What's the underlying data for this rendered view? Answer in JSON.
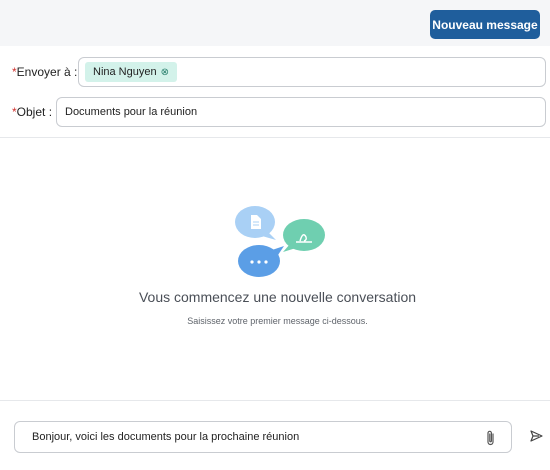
{
  "header": {
    "new_message_label": "Nouveau message"
  },
  "form": {
    "required_mark": "*",
    "to_label": "Envoyer à :",
    "recipients": [
      {
        "name": "Nina Nguyen"
      }
    ],
    "chip_remove_glyph": "⊗",
    "subject_label": "Objet :",
    "subject_value": "Documents pour la réunion"
  },
  "empty_state": {
    "title": "Vous commencez une nouvelle conversation",
    "subtitle": "Saisissez votre premier message ci-dessous."
  },
  "composer": {
    "message_value": "Bonjour, voici les documents pour la prochaine réunion",
    "attach_icon": "paperclip-icon",
    "send_icon": "send-icon"
  },
  "colors": {
    "primary": "#1f5e9c",
    "required": "#d0312d",
    "chip_bg": "#d3f2ea",
    "bubble_blue_light": "#a9d0f5",
    "bubble_green": "#6fcfb0",
    "bubble_blue": "#5b9ee6"
  }
}
